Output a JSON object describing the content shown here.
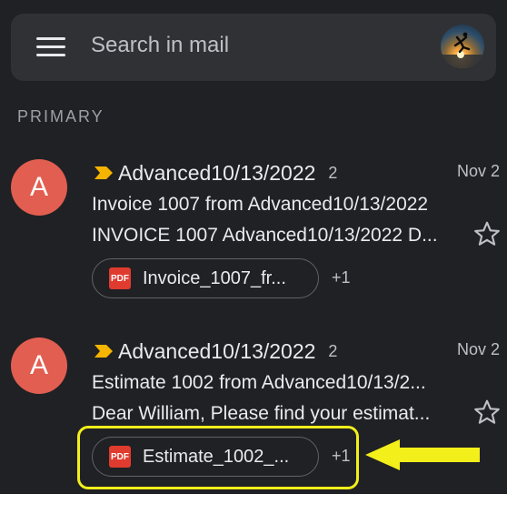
{
  "search": {
    "placeholder": "Search in mail"
  },
  "section_label": "PRIMARY",
  "emails": [
    {
      "avatar_letter": "A",
      "sender": "Advanced10/13/2022",
      "thread_count": "2",
      "date": "Nov 2",
      "subject": "Invoice 1007 from Advanced10/13/2022",
      "snippet": "INVOICE 1007 Advanced10/13/2022 D...",
      "attachment": "Invoice_1007_fr...",
      "attachment_more": "+1"
    },
    {
      "avatar_letter": "A",
      "sender": "Advanced10/13/2022",
      "thread_count": "2",
      "date": "Nov 2",
      "subject": "Estimate 1002 from Advanced10/13/2...",
      "snippet": "Dear William, Please find your estimat...",
      "attachment": "Estimate_1002_...",
      "attachment_more": "+1"
    }
  ],
  "pdf_icon_text": "PDF",
  "colors": {
    "background": "#202124",
    "search_bar": "#303134",
    "avatar": "#e25e51",
    "important_marker": "#f5b400",
    "pdf_icon": "#e03b2f",
    "annotation_highlight": "#f2ef1b"
  },
  "icons": [
    "menu-icon",
    "account-avatar",
    "important-marker-icon",
    "star-icon",
    "pdf-icon",
    "arrow-annotation"
  ]
}
